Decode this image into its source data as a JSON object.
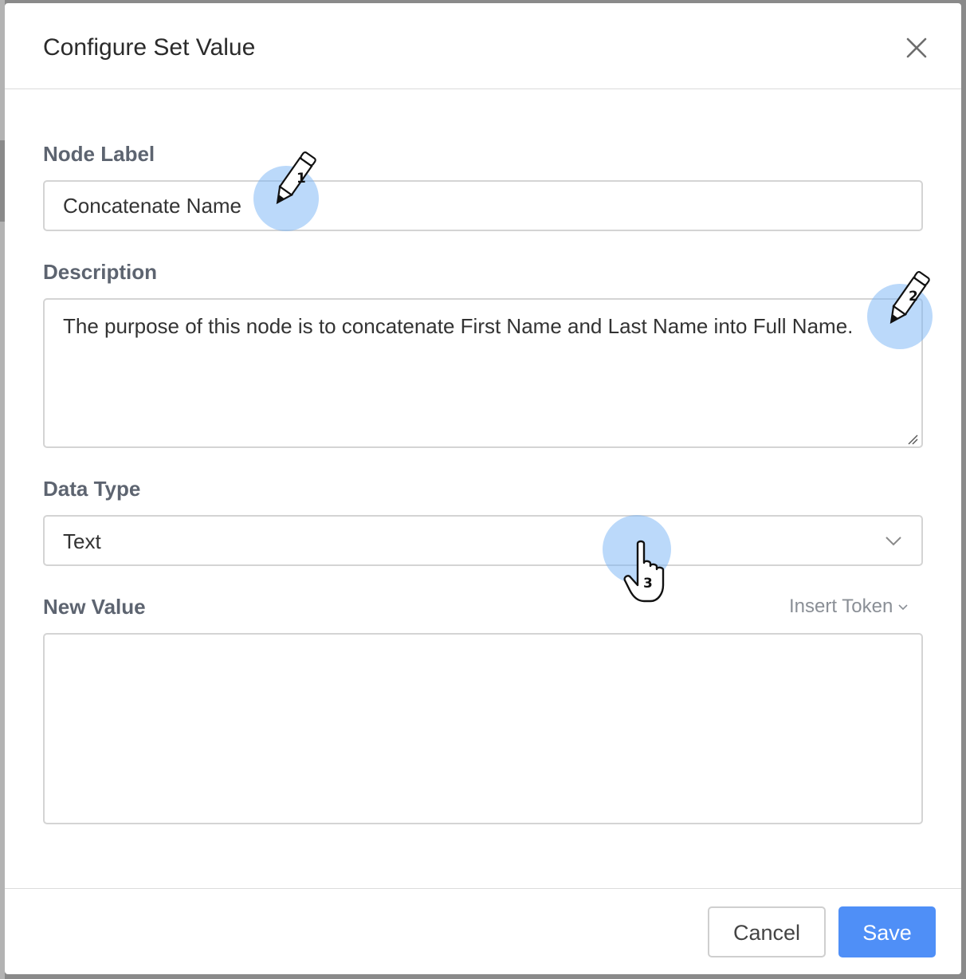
{
  "dialog": {
    "title": "Configure Set Value",
    "close_icon": "close-icon"
  },
  "form": {
    "node_label": {
      "label": "Node Label",
      "value": "Concatenate Name"
    },
    "description": {
      "label": "Description",
      "value": "The purpose of this node is to concatenate First Name and Last Name into Full Name."
    },
    "data_type": {
      "label": "Data Type",
      "selected": "Text",
      "chevron_icon": "chevron-down-icon"
    },
    "new_value": {
      "label": "New Value",
      "value": "",
      "insert_token_label": "Insert Token"
    }
  },
  "footer": {
    "cancel_label": "Cancel",
    "save_label": "Save"
  },
  "annotations": [
    {
      "number": "1",
      "icon": "pencil-icon"
    },
    {
      "number": "2",
      "icon": "pencil-icon"
    },
    {
      "number": "3",
      "icon": "hand-pointer-icon"
    }
  ],
  "colors": {
    "primary": "#4f8ff7",
    "label": "#5d6470",
    "border": "#d4d4d4",
    "marker_halo": "#78b4f5"
  }
}
